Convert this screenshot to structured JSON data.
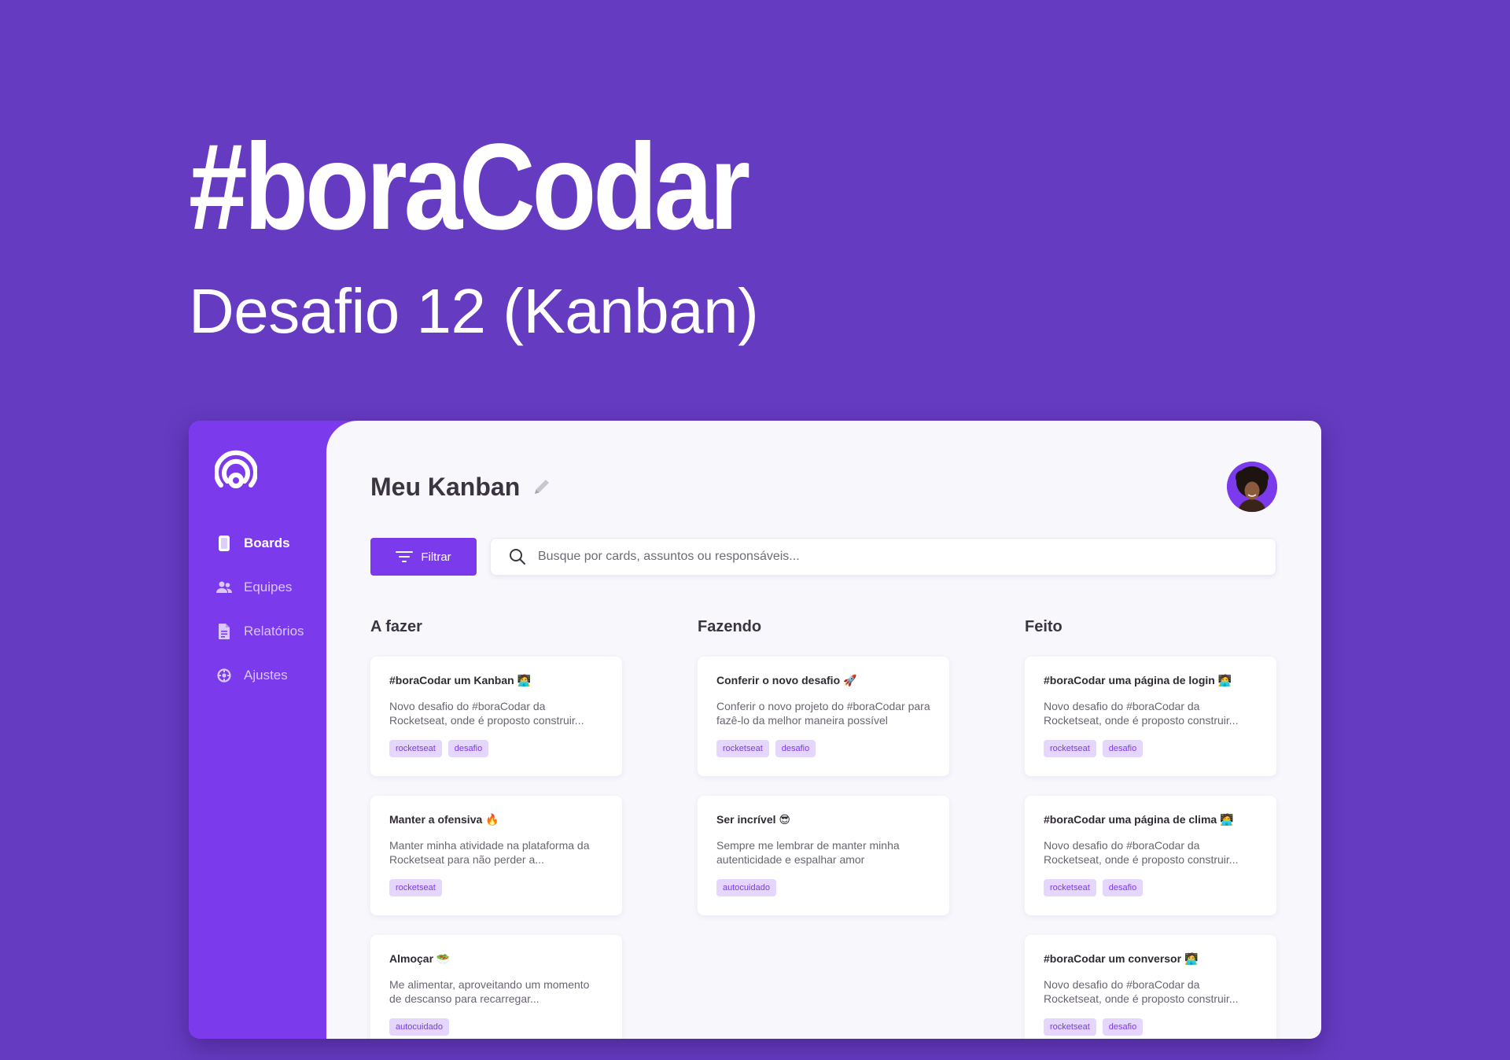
{
  "hero": {
    "title": "#boraCodar",
    "subtitle": "Desafio 12 (Kanban)"
  },
  "colors": {
    "background": "#653bc1",
    "accent": "#7c3aed",
    "tag_bg": "#e4d6fd",
    "main_bg": "#f8f7fc"
  },
  "sidebar": {
    "items": [
      {
        "label": "Boards",
        "icon": "board-icon",
        "active": true
      },
      {
        "label": "Equipes",
        "icon": "team-icon",
        "active": false
      },
      {
        "label": "Relatórios",
        "icon": "report-icon",
        "active": false
      },
      {
        "label": "Ajustes",
        "icon": "settings-icon",
        "active": false
      }
    ]
  },
  "header": {
    "title": "Meu Kanban"
  },
  "toolbar": {
    "filter_label": "Filtrar",
    "search_placeholder": "Busque por cards, assuntos ou responsáveis..."
  },
  "columns": [
    {
      "title": "A fazer",
      "cards": [
        {
          "title": "#boraCodar um Kanban 🧑‍💻",
          "description": "Novo desafio do #boraCodar da Rocketseat, onde é proposto construir...",
          "tags": [
            "rocketseat",
            "desafio"
          ]
        },
        {
          "title": "Manter a ofensiva 🔥",
          "description": "Manter minha atividade na plataforma da Rocketseat para não perder a...",
          "tags": [
            "rocketseat"
          ]
        },
        {
          "title": "Almoçar 🥗",
          "description": "Me alimentar, aproveitando um momento de descanso para recarregar...",
          "tags": [
            "autocuidado"
          ]
        }
      ]
    },
    {
      "title": "Fazendo",
      "cards": [
        {
          "title": "Conferir o novo desafio 🚀",
          "description": "Conferir o novo projeto do #boraCodar para fazê-lo da melhor maneira possível",
          "tags": [
            "rocketseat",
            "desafio"
          ]
        },
        {
          "title": "Ser incrível 😎",
          "description": "Sempre me lembrar de manter minha autenticidade e espalhar amor",
          "tags": [
            "autocuidado"
          ]
        }
      ]
    },
    {
      "title": "Feito",
      "cards": [
        {
          "title": "#boraCodar uma página de login 🧑‍💻",
          "description": "Novo desafio do #boraCodar da Rocketseat, onde é proposto construir...",
          "tags": [
            "rocketseat",
            "desafio"
          ]
        },
        {
          "title": "#boraCodar uma página de clima 🧑‍💻",
          "description": "Novo desafio do #boraCodar da Rocketseat, onde é proposto construir...",
          "tags": [
            "rocketseat",
            "desafio"
          ]
        },
        {
          "title": "#boraCodar um conversor 🧑‍💻",
          "description": "Novo desafio do #boraCodar da Rocketseat, onde é proposto construir...",
          "tags": [
            "rocketseat",
            "desafio"
          ]
        }
      ]
    }
  ]
}
